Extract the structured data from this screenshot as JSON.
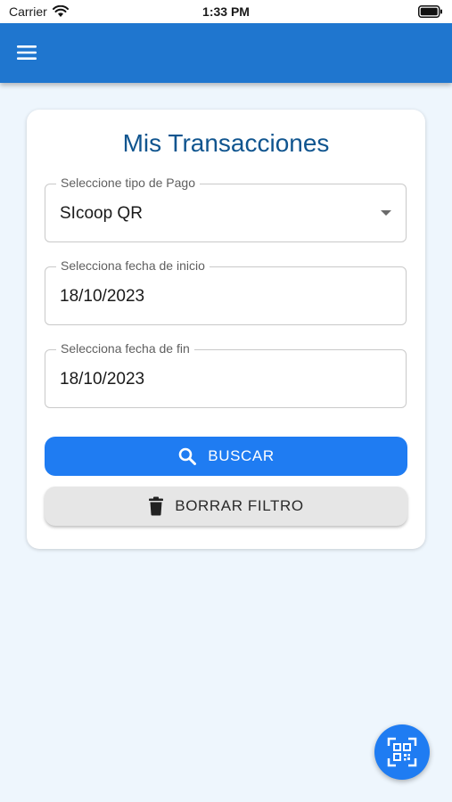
{
  "status_bar": {
    "carrier": "Carrier",
    "time": "1:33 PM"
  },
  "app_bar": {
    "menu_icon": "hamburger-menu-icon"
  },
  "card": {
    "title": "Mis Transacciones",
    "payment_type": {
      "label": "Seleccione tipo de Pago",
      "value": "SIcoop QR"
    },
    "start_date": {
      "label": "Selecciona fecha de inicio",
      "value": "18/10/2023"
    },
    "end_date": {
      "label": "Selecciona fecha de fin",
      "value": "18/10/2023"
    },
    "search_button": "BUSCAR",
    "clear_button": "BORRAR FILTRO"
  },
  "fab": {
    "icon": "qr-scan-icon"
  },
  "colors": {
    "app_bar": "#1f76cf",
    "primary_button": "#1f7cf2",
    "title": "#10558f",
    "background": "#eef6fd"
  }
}
